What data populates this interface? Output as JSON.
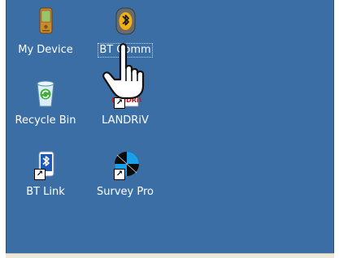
{
  "desktop": {
    "background_color": "#3a6ea5",
    "icons": [
      {
        "label": "My Device",
        "icon": "pda-device-icon"
      },
      {
        "label": "BT Comm",
        "icon": "bluetooth-comm-icon"
      },
      {
        "label": "Recycle Bin",
        "icon": "recycle-bin-icon"
      },
      {
        "label": "LANDRiV",
        "icon": "landriv-icon"
      },
      {
        "label": "BT Link",
        "icon": "bluetooth-link-icon"
      },
      {
        "label": "Survey Pro",
        "icon": "survey-pro-icon"
      }
    ]
  },
  "pointer": {
    "icon": "hand-pointer-icon"
  }
}
